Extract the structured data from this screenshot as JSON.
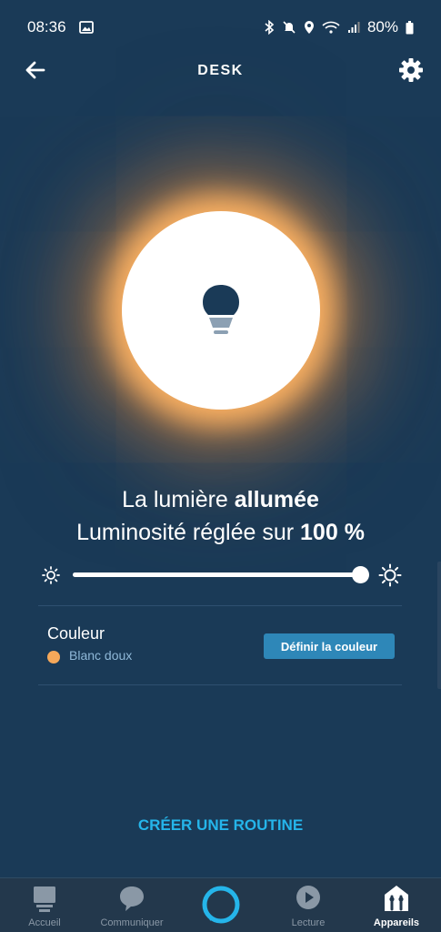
{
  "status_bar": {
    "time": "08:36",
    "battery": "80%"
  },
  "header": {
    "title": "DESK"
  },
  "light": {
    "state_prefix": "La lumière ",
    "state_value": "allumée",
    "brightness_prefix": "Luminosité réglée sur ",
    "brightness_value": "100 %",
    "brightness_level": 1.0
  },
  "color": {
    "label": "Couleur",
    "value": "Blanc doux",
    "swatch": "#f5a85a",
    "button_label": "Définir la couleur"
  },
  "routine": {
    "label": "CRÉER UNE ROUTINE"
  },
  "nav": {
    "items": [
      {
        "label": "Accueil",
        "icon": "home-icon"
      },
      {
        "label": "Communiquer",
        "icon": "chat-bubble-icon"
      },
      {
        "label": "",
        "icon": "alexa-icon"
      },
      {
        "label": "Lecture",
        "icon": "play-icon"
      },
      {
        "label": "Appareils",
        "icon": "devices-icon"
      }
    ],
    "active": "Appareils"
  },
  "colors": {
    "background": "#1a3a57",
    "accent": "#25b5ea",
    "button": "#2e87b8"
  }
}
